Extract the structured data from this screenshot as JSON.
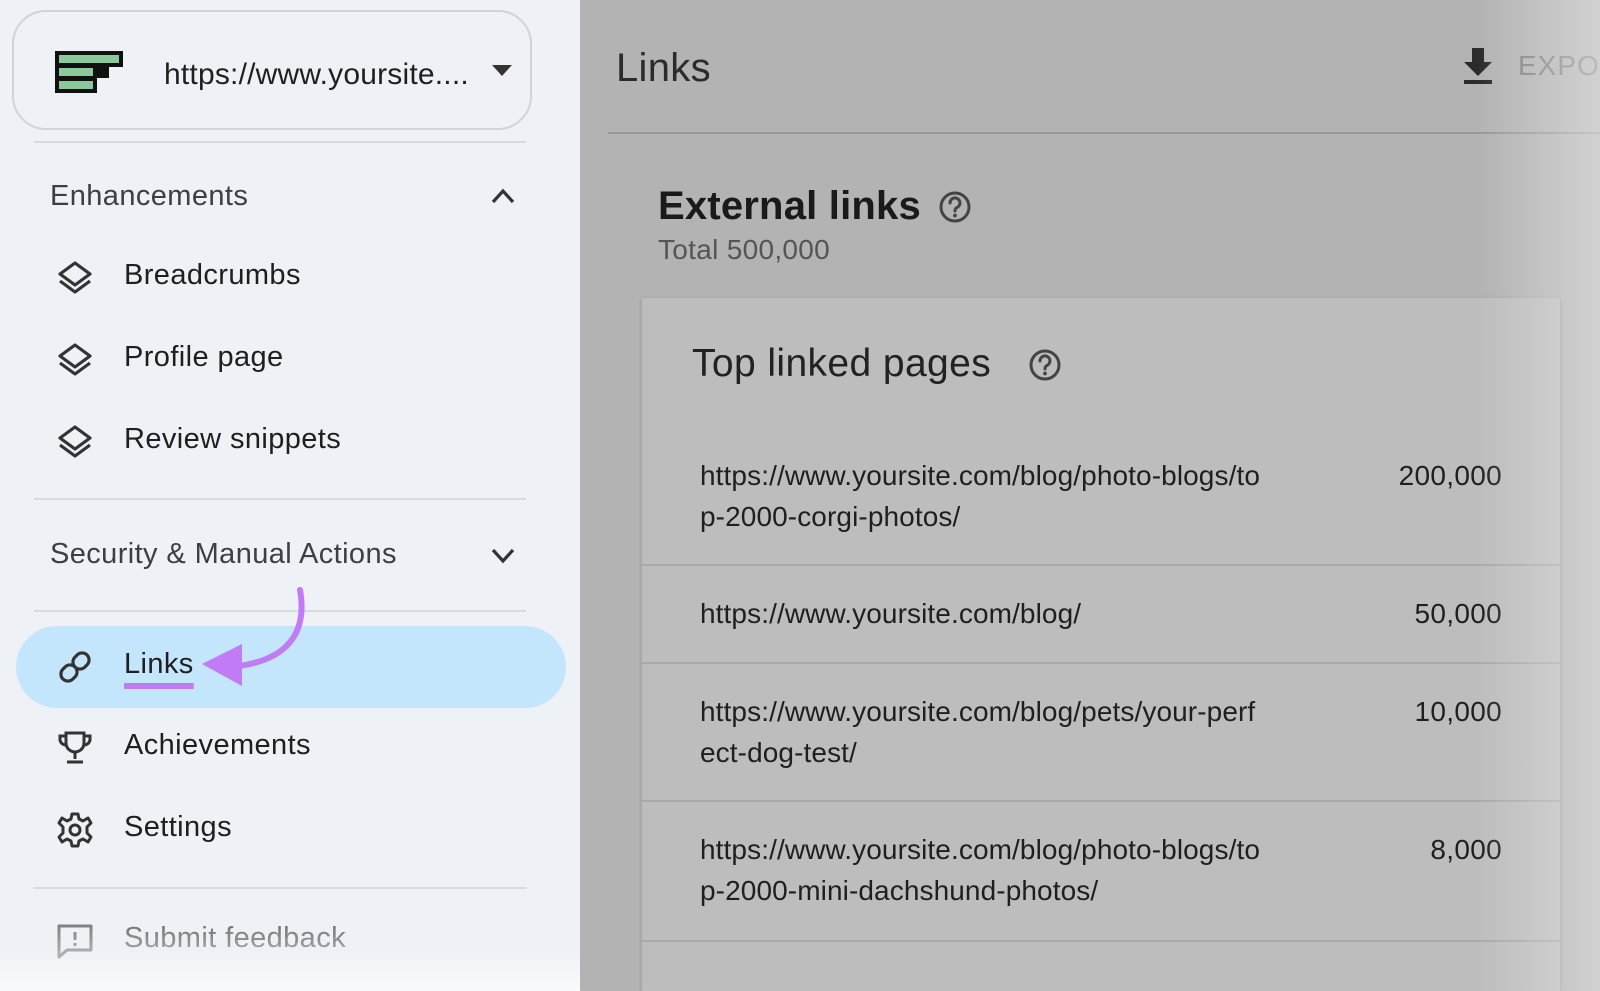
{
  "property": {
    "url": "https://www.yoursite....",
    "logo_colors": {
      "fill": "#8cc99a",
      "stroke": "#111111"
    }
  },
  "sidebar": {
    "sections": [
      {
        "label": "Enhancements",
        "state": "expanded",
        "items": [
          {
            "label": "Breadcrumbs",
            "icon": "layers-icon"
          },
          {
            "label": "Profile page",
            "icon": "layers-icon"
          },
          {
            "label": "Review snippets",
            "icon": "layers-icon"
          }
        ]
      },
      {
        "label": "Security & Manual Actions",
        "state": "collapsed"
      }
    ],
    "nav": [
      {
        "label": "Links",
        "icon": "link-icon",
        "active": true
      },
      {
        "label": "Achievements",
        "icon": "trophy-icon",
        "active": false
      },
      {
        "label": "Settings",
        "icon": "gear-icon",
        "active": false
      }
    ],
    "feedback": {
      "label": "Submit feedback",
      "icon": "feedback-icon"
    },
    "colors": {
      "active_bg": "#c3e6fc",
      "annotation": "#c07bf5"
    }
  },
  "main": {
    "title": "Links",
    "export_label": "EXPO",
    "external_links": {
      "title": "External links",
      "total": "Total 500,000"
    },
    "top_linked_pages": {
      "title": "Top linked pages",
      "rows": [
        {
          "url": "https://www.yoursite.com/blog/photo-blogs/top-2000-corgi-photos/",
          "count": "200,000"
        },
        {
          "url": "https://www.yoursite.com/blog/",
          "count": "50,000"
        },
        {
          "url": "https://www.yoursite.com/blog/pets/your-perfect-dog-test/",
          "count": "10,000"
        },
        {
          "url": "https://www.yoursite.com/blog/photo-blogs/top-2000-mini-dachshund-photos/",
          "count": "8,000"
        }
      ]
    }
  }
}
